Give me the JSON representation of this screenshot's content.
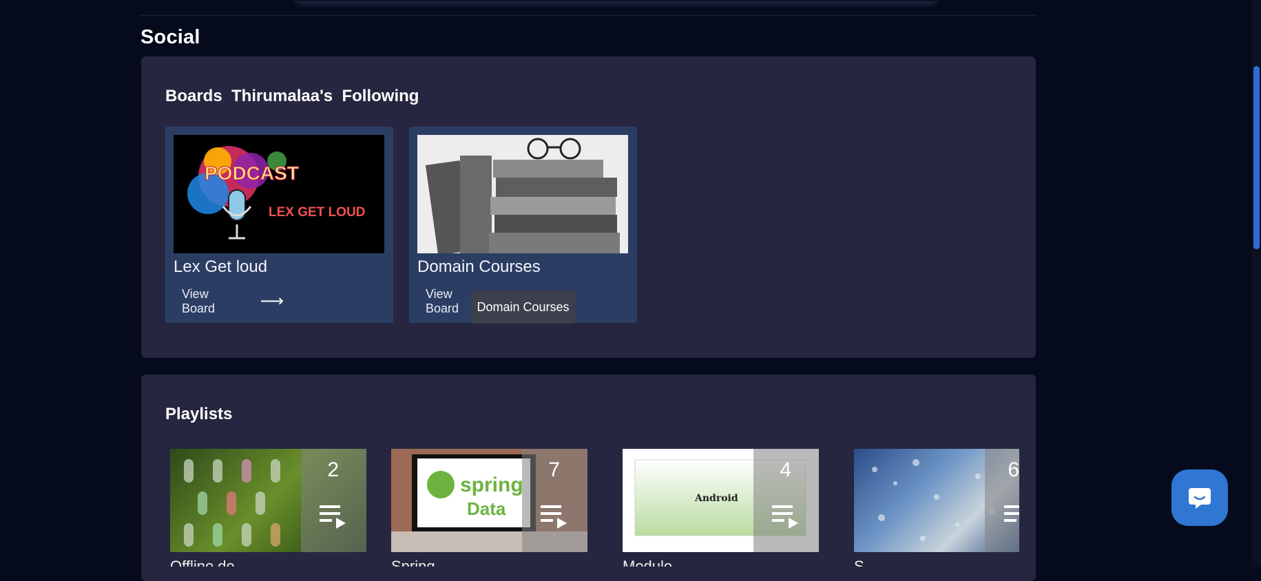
{
  "section": {
    "title": "Social"
  },
  "boards": {
    "heading": "Boards  Thirumalaa's  Following",
    "items": [
      {
        "name": "Lex Get loud",
        "view_label": "View Board",
        "image_text_top": "PODCAST",
        "image_text_bottom": "LEX GET LOUD"
      },
      {
        "name": "Domain Courses",
        "view_label": "View Board"
      }
    ],
    "tooltip": "Domain Courses"
  },
  "playlists": {
    "heading": "Playlists",
    "items": [
      {
        "count": "2",
        "title": "Offline de..."
      },
      {
        "count": "7",
        "title": "Spring ...",
        "image_text_1": "spring",
        "image_text_2": "Data"
      },
      {
        "count": "4",
        "title": "Module ...",
        "image_text": "Android"
      },
      {
        "count": "6",
        "title": "S..."
      }
    ]
  },
  "colors": {
    "background": "#050b1c",
    "panel": "#262640",
    "card": "#2c3d63",
    "accent": "#2f77d3"
  },
  "icons": {
    "playlist": "playlist-play-icon",
    "arrow": "arrow-right-icon",
    "chat": "chat-icon"
  }
}
